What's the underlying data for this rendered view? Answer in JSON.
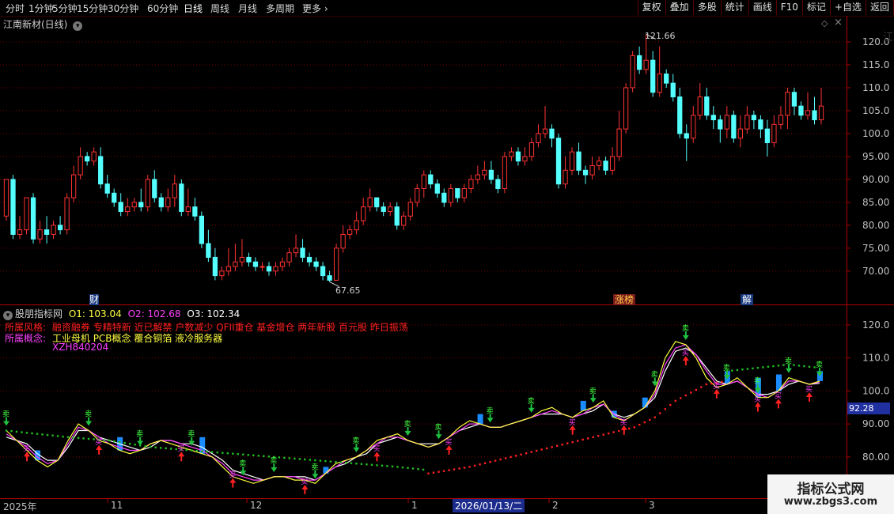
{
  "toolbar": {
    "tabs": [
      "分时",
      "1分钟",
      "5分钟",
      "15分钟",
      "30分钟",
      "60分钟",
      "日线",
      "周线",
      "月线",
      "多周期",
      "更多"
    ],
    "active_tab": "日线",
    "right_buttons": [
      "复权",
      "叠加",
      "多股",
      "统计",
      "画线",
      "F10",
      "标记",
      "+自选",
      "返回"
    ]
  },
  "main": {
    "title": "江南新材(日线)",
    "price_high_label": "121.66",
    "price_low_label": "67.65",
    "y_ticks": [
      "120.0",
      "115.0",
      "110.0",
      "105.0",
      "100.0",
      "95.00",
      "90.00",
      "85.00",
      "80.00",
      "75.00",
      "70.00"
    ],
    "event_markers": [
      {
        "text": "财",
        "color": "#ffffff",
        "bg": "#1a3a80"
      },
      {
        "text": "涨榜",
        "color": "#ffd24a",
        "bg": "#7a1a1a"
      },
      {
        "text": "解",
        "color": "#ffffff",
        "bg": "#1a3a80"
      }
    ],
    "side_text": "江南新材"
  },
  "indicator": {
    "name": "股朋指标网",
    "o1_label": "O1: 103.04",
    "o2_label": "O2: 102.68",
    "o3_label": "O3: 102.34",
    "style_label": "所属风格:",
    "style_value": "融资融券 专精特新 近已解禁 户数减少 QFII重仓 基金增仓 两年新股 百元股 昨日振荡",
    "concept_label": "所属概念:",
    "concept_value": "工业母机 PCB概念 覆合铜箔 液冷服务器",
    "code": "XZH840204",
    "y_ticks": [
      "120.0",
      "110.0",
      "100.0",
      "90.00",
      "80.00"
    ],
    "current_value": "92.28",
    "buy_glyph": "买",
    "sell_glyph": "卖"
  },
  "date_axis": {
    "labels": [
      "2025年",
      "11",
      "12",
      "1",
      "2",
      "3"
    ],
    "cursor_date": "2026/01/13/二"
  },
  "watermark": {
    "title": "指标公式网",
    "url": "www.zbgs3.com"
  },
  "colors": {
    "up": "#ff3232",
    "down": "#54ffff",
    "axis": "#b00000",
    "grid": "#7a0000",
    "o1": "#ffff40",
    "o2": "#ff40ff",
    "o3": "#ffffff",
    "dots_red": "#ff2020",
    "dots_green": "#20c020"
  },
  "chart_data": {
    "type": "candlestick",
    "ylim": [
      66,
      125
    ],
    "candles": [
      [
        82,
        90,
        81,
        90
      ],
      [
        90,
        78,
        77,
        91
      ],
      [
        78,
        79,
        77,
        82
      ],
      [
        79,
        86,
        78,
        86
      ],
      [
        86,
        77,
        76,
        87
      ],
      [
        77,
        79,
        76,
        81
      ],
      [
        79,
        78,
        76,
        82
      ],
      [
        78,
        80,
        77,
        81
      ],
      [
        80,
        79,
        78,
        82
      ],
      [
        79,
        86,
        78,
        87
      ],
      [
        86,
        91,
        85,
        93
      ],
      [
        91,
        95,
        90,
        97
      ],
      [
        95,
        94,
        93,
        96
      ],
      [
        94,
        96,
        93,
        97
      ],
      [
        95,
        89,
        88,
        97
      ],
      [
        89,
        87,
        86,
        91
      ],
      [
        87,
        85,
        84,
        88
      ],
      [
        85,
        83,
        82,
        87
      ],
      [
        83,
        84,
        82,
        86
      ],
      [
        84,
        85,
        83,
        86
      ],
      [
        85,
        84,
        83,
        88
      ],
      [
        84,
        90,
        83,
        91
      ],
      [
        90,
        86,
        85,
        92
      ],
      [
        86,
        84,
        83,
        87
      ],
      [
        84,
        86,
        83,
        88
      ],
      [
        86,
        89,
        84,
        91
      ],
      [
        89,
        83,
        82,
        90
      ],
      [
        83,
        84,
        82,
        88
      ],
      [
        84,
        82,
        81,
        86
      ],
      [
        82,
        76,
        75,
        83
      ],
      [
        76,
        73,
        72,
        79
      ],
      [
        73,
        69,
        68,
        75
      ],
      [
        69,
        70,
        68,
        71
      ],
      [
        70,
        71,
        69,
        75
      ],
      [
        71,
        72,
        70,
        76
      ],
      [
        72,
        73,
        71,
        77
      ],
      [
        73,
        72,
        71,
        74
      ],
      [
        72,
        71,
        70,
        73
      ],
      [
        71,
        71,
        70,
        72
      ],
      [
        71,
        70,
        69,
        72
      ],
      [
        70,
        71,
        69,
        72
      ],
      [
        71,
        72,
        70,
        73
      ],
      [
        72,
        74,
        71,
        75
      ],
      [
        74,
        75,
        73,
        78
      ],
      [
        75,
        73,
        72,
        77
      ],
      [
        73,
        72,
        71,
        74
      ],
      [
        72,
        71,
        70,
        73
      ],
      [
        71,
        69,
        68,
        72
      ],
      [
        69,
        68,
        67.65,
        70
      ],
      [
        68,
        75,
        68,
        76
      ],
      [
        75,
        78,
        74,
        80
      ],
      [
        78,
        79,
        77,
        80
      ],
      [
        79,
        81,
        78,
        83
      ],
      [
        81,
        84,
        80,
        86
      ],
      [
        84,
        86,
        83,
        88
      ],
      [
        86,
        84,
        83,
        86
      ],
      [
        84,
        83,
        82,
        85
      ],
      [
        83,
        84,
        82,
        85
      ],
      [
        84,
        80,
        79,
        85
      ],
      [
        80,
        82,
        79,
        83
      ],
      [
        82,
        85,
        81,
        86
      ],
      [
        85,
        88,
        84,
        89
      ],
      [
        88,
        91,
        86,
        92
      ],
      [
        91,
        89,
        88,
        92
      ],
      [
        89,
        87,
        86,
        90
      ],
      [
        87,
        85,
        84,
        88
      ],
      [
        85,
        88,
        84,
        89
      ],
      [
        88,
        86,
        85,
        88
      ],
      [
        86,
        88,
        85,
        89
      ],
      [
        88,
        90,
        87,
        91
      ],
      [
        90,
        91,
        89,
        93
      ],
      [
        91,
        92,
        90,
        94
      ],
      [
        92,
        90,
        89,
        94
      ],
      [
        90,
        88,
        87,
        91
      ],
      [
        88,
        95,
        87,
        96
      ],
      [
        95,
        96,
        94,
        97
      ],
      [
        96,
        94,
        93,
        97
      ],
      [
        94,
        95,
        93,
        97
      ],
      [
        95,
        98,
        94,
        99
      ],
      [
        98,
        100,
        97,
        102
      ],
      [
        100,
        101,
        99,
        106
      ],
      [
        101,
        99,
        97,
        102
      ],
      [
        99,
        89,
        88,
        100
      ],
      [
        89,
        92,
        88,
        95
      ],
      [
        92,
        96,
        91,
        97
      ],
      [
        96,
        92,
        91,
        98
      ],
      [
        92,
        91,
        89,
        93
      ],
      [
        91,
        93,
        90,
        95
      ],
      [
        93,
        94,
        92,
        95
      ],
      [
        94,
        92,
        91,
        95
      ],
      [
        92,
        95,
        91,
        97
      ],
      [
        95,
        101,
        94,
        105
      ],
      [
        101,
        110,
        100,
        111
      ],
      [
        110,
        117,
        109,
        118
      ],
      [
        117,
        114,
        113,
        119
      ],
      [
        114,
        116,
        113,
        121.66
      ],
      [
        116,
        109,
        108,
        118
      ],
      [
        109,
        113,
        108,
        119
      ],
      [
        113,
        111,
        110,
        114
      ],
      [
        111,
        108,
        107,
        113
      ],
      [
        108,
        100,
        99,
        110
      ],
      [
        100,
        99,
        94,
        102
      ],
      [
        99,
        104,
        98,
        106
      ],
      [
        104,
        108,
        103,
        111
      ],
      [
        108,
        104,
        103,
        110
      ],
      [
        104,
        103,
        101,
        106
      ],
      [
        103,
        101,
        98,
        104
      ],
      [
        101,
        104,
        99,
        106
      ],
      [
        104,
        99,
        98,
        105
      ],
      [
        99,
        101,
        97,
        104
      ],
      [
        101,
        104,
        100,
        106
      ],
      [
        104,
        103,
        101,
        105
      ],
      [
        103,
        101,
        99,
        104
      ],
      [
        101,
        98,
        95,
        103
      ],
      [
        98,
        102,
        97,
        104
      ],
      [
        102,
        104,
        101,
        106
      ],
      [
        104,
        109,
        101,
        110
      ],
      [
        109,
        106,
        104,
        110
      ],
      [
        106,
        104,
        103,
        107
      ],
      [
        104,
        105,
        103,
        109
      ],
      [
        105,
        103,
        102,
        108
      ],
      [
        103,
        106,
        102,
        110
      ]
    ],
    "indicator": {
      "ylim": [
        68,
        125
      ],
      "o1": [
        88,
        85,
        82,
        79,
        77,
        79,
        85,
        90,
        88,
        85,
        84,
        82,
        81,
        82,
        84,
        85,
        84,
        83,
        82,
        81,
        80,
        77,
        74,
        73,
        72,
        73,
        74,
        74,
        73,
        73,
        72,
        75,
        78,
        79,
        80,
        82,
        85,
        86,
        87,
        85,
        84,
        83,
        84,
        86,
        89,
        91,
        90,
        89,
        89,
        90,
        91,
        92,
        94,
        95,
        93,
        92,
        94,
        95,
        97,
        92,
        91,
        93,
        95,
        100,
        110,
        115,
        114,
        110,
        104,
        101,
        102,
        104,
        101,
        98,
        98,
        100,
        104,
        103,
        102,
        103
      ],
      "o2": [
        87,
        85,
        83,
        80,
        78,
        79,
        84,
        89,
        88,
        86,
        84,
        83,
        82,
        82,
        84,
        85,
        85,
        84,
        83,
        82,
        80,
        78,
        75,
        74,
        73,
        73,
        74,
        74,
        74,
        73,
        73,
        75,
        77,
        79,
        80,
        82,
        84,
        86,
        86,
        85,
        84,
        83,
        84,
        86,
        88,
        90,
        90,
        89,
        89,
        90,
        91,
        92,
        93,
        94,
        93,
        92,
        93,
        95,
        96,
        93,
        91,
        93,
        95,
        99,
        108,
        113,
        114,
        111,
        106,
        102,
        102,
        103,
        101,
        99,
        98,
        100,
        103,
        103,
        102,
        102.7
      ],
      "o3": [
        86,
        85,
        84,
        81,
        79,
        79,
        83,
        88,
        88,
        86,
        85,
        84,
        83,
        82,
        83,
        85,
        85,
        84,
        84,
        83,
        81,
        79,
        76,
        75,
        74,
        73,
        74,
        74,
        74,
        74,
        73,
        75,
        77,
        78,
        80,
        81,
        84,
        85,
        86,
        85,
        84,
        84,
        84,
        86,
        88,
        89,
        90,
        89,
        89,
        90,
        91,
        92,
        93,
        93,
        93,
        92,
        93,
        94,
        96,
        93,
        92,
        93,
        95,
        98,
        106,
        112,
        113,
        111,
        107,
        103,
        102,
        103,
        101,
        99,
        99,
        100,
        102,
        103,
        102,
        102.3
      ],
      "dots_green": [
        [
          0,
          88
        ],
        [
          6,
          86
        ],
        [
          10,
          85
        ],
        [
          14,
          83
        ],
        [
          18,
          82
        ],
        [
          22,
          81
        ],
        [
          26,
          80
        ],
        [
          30,
          79
        ],
        [
          34,
          78
        ],
        [
          38,
          77
        ],
        [
          41,
          76
        ]
      ],
      "dots_red": [
        [
          41,
          75
        ],
        [
          45,
          77
        ],
        [
          49,
          80
        ],
        [
          53,
          83
        ],
        [
          57,
          86
        ],
        [
          61,
          89
        ],
        [
          63,
          92
        ],
        [
          65,
          97
        ],
        [
          68,
          102
        ],
        [
          70,
          103
        ]
      ],
      "dots_green2": [
        [
          70,
          106
        ],
        [
          73,
          107
        ],
        [
          76,
          108
        ],
        [
          79,
          107
        ]
      ]
    }
  }
}
